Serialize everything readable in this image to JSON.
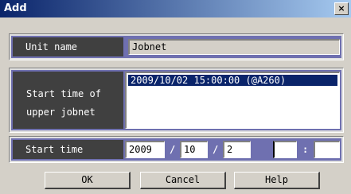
{
  "window": {
    "title": "Add",
    "close_icon": "×"
  },
  "unit_name": {
    "label": "Unit name",
    "value": "Jobnet"
  },
  "upper_jobnet": {
    "label_line1": "Start time of",
    "label_line2": "upper jobnet",
    "items": [
      "2009/10/02 15:00:00 (@A260)"
    ]
  },
  "start_time": {
    "label": "Start time",
    "year": "2009",
    "month": "10",
    "day": "2",
    "hour": "",
    "minute": "",
    "date_separator": "/",
    "time_separator": ":"
  },
  "buttons": {
    "ok": "OK",
    "cancel": "Cancel",
    "help": "Help"
  }
}
